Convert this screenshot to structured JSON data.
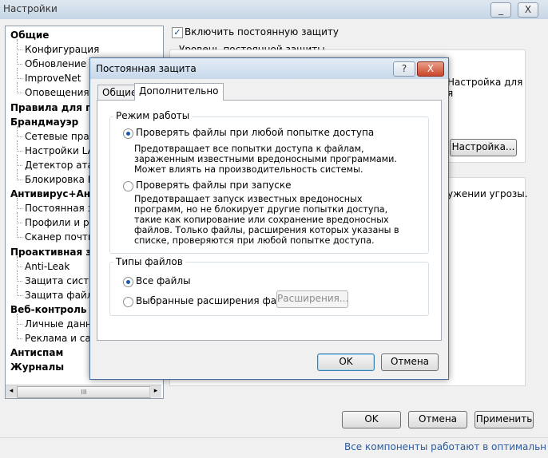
{
  "main_window": {
    "title": "Настройки",
    "min_btn": "_",
    "close_btn": "X",
    "enable_protection_label": "Включить постоянную защиту",
    "protection_level_label": "Уровень постоянной защиты",
    "right_text_1": "Настройка для",
    "right_text_2": "я",
    "right_text_3": "ужении угрозы.",
    "configure_button": "Настройка...",
    "ok_button": "OK",
    "cancel_button": "Отмена",
    "apply_button": "Применить",
    "status_text": "Все компоненты работают в оптимальн",
    "hscroll_grip": "III"
  },
  "tree": [
    {
      "label": "Общие",
      "type": "cat"
    },
    {
      "label": "Конфигурация",
      "type": "item"
    },
    {
      "label": "Обновление",
      "type": "item"
    },
    {
      "label": "ImproveNet",
      "type": "item"
    },
    {
      "label": "Оповещения",
      "type": "item"
    },
    {
      "label": "Правила для при",
      "type": "cat"
    },
    {
      "label": "Брандмауэр",
      "type": "cat"
    },
    {
      "label": "Сетевые прави",
      "type": "item"
    },
    {
      "label": "Настройки LAN",
      "type": "item"
    },
    {
      "label": "Детектор атак",
      "type": "item"
    },
    {
      "label": "Блокировка IP",
      "type": "item"
    },
    {
      "label": "Антивирус+Антиш",
      "type": "cat"
    },
    {
      "label": "Постоянная за",
      "type": "item"
    },
    {
      "label": "Профили и рас",
      "type": "item"
    },
    {
      "label": "Сканер почты",
      "type": "item"
    },
    {
      "label": "Проактивная защ",
      "type": "cat"
    },
    {
      "label": "Anti-Leak",
      "type": "item"
    },
    {
      "label": "Защита систем",
      "type": "item"
    },
    {
      "label": "Защита файло",
      "type": "item"
    },
    {
      "label": "Веб-контроль",
      "type": "cat"
    },
    {
      "label": "Личные данны",
      "type": "item"
    },
    {
      "label": "Реклама и сайт",
      "type": "item"
    },
    {
      "label": "Антиспам",
      "type": "cat"
    },
    {
      "label": "Журналы",
      "type": "cat"
    }
  ],
  "dialog": {
    "title": "Постоянная защита",
    "help_btn": "?",
    "close_btn": "X",
    "tabs": [
      "Общие",
      "Дополнительно"
    ],
    "mode_group_title": "Режим работы",
    "radio_access_label": "Проверять файлы при любой попытке доступа",
    "radio_access_desc": "Предотвращает все попытки доступа к файлам, зараженным известными вредоносными программами. Может влиять на производительность системы.",
    "radio_launch_label": "Проверять файлы при запуске",
    "radio_launch_desc": "Предотвращает запуск известных вредоносных программ, но не блокирует другие попытки доступа, такие как копирование или сохранение вредоносных файлов. Только файлы, расширения которых указаны в списке, проверяются при любой попытке доступа.",
    "filetypes_group_title": "Типы файлов",
    "radio_all_label": "Все файлы",
    "radio_selected_label": "Выбранные расширения файлов",
    "extensions_button": "Расширения...",
    "ok_button": "OK",
    "cancel_button": "Отмена"
  },
  "colors": {
    "accent_blue": "#1a5aa8",
    "status_text": "#2a5aa0"
  }
}
